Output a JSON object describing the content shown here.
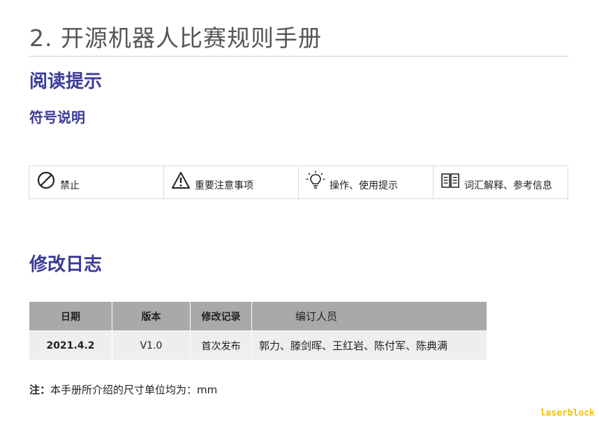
{
  "document": {
    "title": "2. 开源机器人比赛规则手册",
    "reading_tips_heading": "阅读提示",
    "symbols_heading": "符号说明",
    "symbols": [
      {
        "icon": "prohibited-icon",
        "label": "禁止"
      },
      {
        "icon": "warning-icon",
        "label": "重要注意事项"
      },
      {
        "icon": "lightbulb-icon",
        "label": "操作、使用提示"
      },
      {
        "icon": "book-icon",
        "label": "词汇解释、参考信息"
      }
    ],
    "changelog_heading": "修改日志",
    "changelog": {
      "headers": [
        "日期",
        "版本",
        "修改记录",
        "编订人员"
      ],
      "rows": [
        [
          "2021.4.2",
          "V1.0",
          "首次发布",
          "郭力、滕剑晖、王红岩、陈付军、陈典满"
        ]
      ]
    },
    "note_prefix": "注：",
    "note_text": "本手册所介绍的尺寸单位均为：mm"
  },
  "watermark": "laserblock",
  "colors": {
    "heading": "#3b3b96",
    "title": "#555555",
    "table_header_bg": "#a9a9a9",
    "table_row_bg": "#eeeeee",
    "watermark": "#f2c300"
  }
}
